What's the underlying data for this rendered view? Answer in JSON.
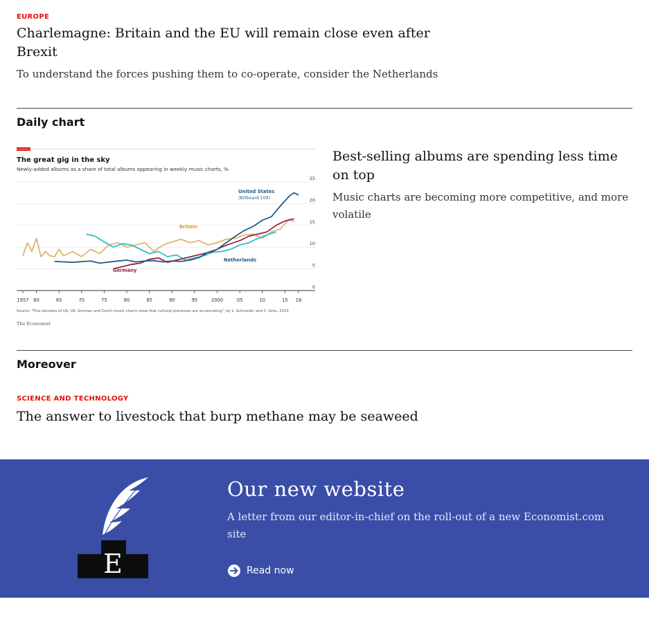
{
  "colors": {
    "accent_red": "#e3120b",
    "text": "#121212",
    "rule": "#4a4a4a",
    "banner_bg": "#3a4ea8",
    "series_us": "#1e5c8c",
    "series_netherlands": "#2ebfc6",
    "series_germany": "#9b2143",
    "series_britain": "#e1b36b"
  },
  "europe_article": {
    "section": "EUROPE",
    "headline": "Charlemagne: Britain and the EU will remain close even after Brexit",
    "rubric": "To understand the forces pushing them to co-operate, consider the Netherlands"
  },
  "daily_chart": {
    "section_title": "Daily chart",
    "article": {
      "headline": "Best-selling albums are spending less time on top",
      "rubric": "Music charts are becoming more competitive, and more volatile"
    }
  },
  "chart_data": {
    "type": "line",
    "title": "The great gig in the sky",
    "subtitle": "Newly-added albums as a share of total albums appearing in weekly music charts, %",
    "source": "Source: \"Five decades of US, UK, German and Dutch music charts show that cultural processes are accelerating\", by L. Schneider and C. Gros, 2019",
    "credit": "The Economist",
    "x_ticks": [
      "1957",
      "60",
      "65",
      "70",
      "75",
      "80",
      "85",
      "90",
      "95",
      "2000",
      "05",
      "10",
      "15",
      "18"
    ],
    "y_ticks": [
      "0",
      "5",
      "10",
      "15",
      "20",
      "25"
    ],
    "xlim": [
      1957,
      2018
    ],
    "ylim": [
      0,
      25
    ],
    "grid": true,
    "series": [
      {
        "name": "United States (Billboard 100)",
        "color": "#1e5c8c",
        "x": [
          1964,
          1968,
          1972,
          1974,
          1978,
          1980,
          1982,
          1984,
          1986,
          1988,
          1990,
          1992,
          1994,
          1996,
          1998,
          2000,
          2002,
          2004,
          2006,
          2008,
          2010,
          2012,
          2014,
          2016,
          2017,
          2018
        ],
        "y": [
          6.7,
          6.5,
          6.8,
          6.3,
          6.8,
          7.0,
          6.6,
          6.8,
          6.9,
          6.6,
          6.8,
          6.7,
          7.0,
          7.6,
          8.8,
          9.5,
          11.0,
          12.5,
          13.8,
          14.8,
          16.2,
          17.0,
          19.5,
          21.8,
          22.5,
          22.0
        ]
      },
      {
        "name": "Netherlands",
        "color": "#2ebfc6",
        "x": [
          1971,
          1973,
          1975,
          1977,
          1979,
          1981,
          1983,
          1985,
          1987,
          1989,
          1991,
          1993,
          1995,
          1997,
          1999,
          2001,
          2003,
          2005,
          2007,
          2009,
          2011,
          2013
        ],
        "y": [
          13.0,
          12.5,
          11.2,
          10.0,
          10.8,
          10.5,
          9.5,
          8.5,
          9.0,
          7.8,
          8.2,
          7.0,
          7.5,
          8.0,
          8.8,
          9.0,
          9.5,
          10.5,
          11.0,
          12.0,
          12.8,
          13.5
        ]
      },
      {
        "name": "Germany",
        "color": "#9b2143",
        "x": [
          1977,
          1979,
          1981,
          1983,
          1985,
          1987,
          1989,
          1991,
          1993,
          1995,
          1997,
          1999,
          2001,
          2003,
          2005,
          2007,
          2009,
          2011,
          2013,
          2015,
          2017
        ],
        "y": [
          5.0,
          5.5,
          6.0,
          6.3,
          7.2,
          7.5,
          6.5,
          7.0,
          7.5,
          8.0,
          8.5,
          9.0,
          10.0,
          10.8,
          11.5,
          12.5,
          13.0,
          13.5,
          15.0,
          16.0,
          16.5
        ]
      },
      {
        "name": "Britain",
        "color": "#e1b36b",
        "x": [
          1957,
          1958,
          1959,
          1960,
          1961,
          1962,
          1963,
          1964,
          1965,
          1966,
          1968,
          1970,
          1972,
          1974,
          1976,
          1978,
          1980,
          1982,
          1984,
          1986,
          1988,
          1990,
          1992,
          1994,
          1996,
          1998,
          2000,
          2002,
          2004,
          2006,
          2008,
          2010,
          2012,
          2014,
          2016,
          2017
        ],
        "y": [
          8.0,
          11.0,
          9.0,
          12.0,
          7.8,
          9.0,
          8.0,
          7.8,
          9.5,
          8.0,
          9.0,
          7.8,
          9.5,
          8.5,
          10.5,
          11.0,
          10.0,
          10.5,
          11.0,
          9.0,
          10.5,
          11.2,
          11.8,
          11.0,
          11.5,
          10.5,
          11.0,
          11.8,
          12.0,
          12.8,
          13.0,
          12.0,
          13.5,
          14.2,
          16.5,
          15.8
        ]
      }
    ]
  },
  "moreover": {
    "section_title": "Moreover",
    "article": {
      "section": "SCIENCE AND TECHNOLOGY",
      "headline": "The answer to livestock that burp methane may be seaweed"
    }
  },
  "banner": {
    "title": "Our new website",
    "text": "A letter from our editor-in-chief on the roll-out of a new Economist.com site",
    "cta": "Read now",
    "logo_letter": "E"
  }
}
